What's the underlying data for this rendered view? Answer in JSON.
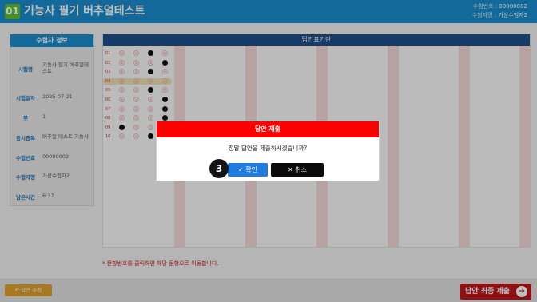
{
  "header": {
    "number": "01",
    "title": "기능사 필기 버추얼테스트",
    "exam_no_label": "수험번호 :",
    "exam_no": "00000002",
    "name_label": "수험자명 :",
    "name": "가상수험자2"
  },
  "info_panel": {
    "title": "수험자 정보",
    "rows": [
      {
        "key": "시험명",
        "value": "기능사 필기 버추얼테스트"
      },
      {
        "key": "시험일자",
        "value": "2025-07-21"
      },
      {
        "key": "부",
        "value": "1"
      },
      {
        "key": "응시종목",
        "value": "버추얼 테스트 기능사"
      },
      {
        "key": "수험번호",
        "value": "00000002"
      },
      {
        "key": "수험자명",
        "value": "가상수험자2"
      },
      {
        "key": "남은시간",
        "value": "6:37"
      }
    ]
  },
  "answer_sheet": {
    "title": "답안표기란",
    "options": [
      "①",
      "②",
      "③",
      "④"
    ],
    "questions": [
      {
        "number": "01",
        "selected": 3
      },
      {
        "number": "02",
        "selected": 4
      },
      {
        "number": "03",
        "selected": 3
      },
      {
        "number": "04",
        "selected": 0
      },
      {
        "number": "05",
        "selected": 3
      },
      {
        "number": "06",
        "selected": 4
      },
      {
        "number": "07",
        "selected": 4
      },
      {
        "number": "08",
        "selected": 4
      },
      {
        "number": "09",
        "selected": 1
      },
      {
        "number": "10",
        "selected": 3
      }
    ]
  },
  "note": "* 문항번호를 클릭하면 해당 문항으로 이동합니다.",
  "footer": {
    "back_label": "↶ 답안 수정",
    "submit_label": "답안 최종 제출",
    "submit_icon": "arrow-right-circle-icon"
  },
  "dialog": {
    "title": "답안 제출",
    "message": "정말 답안을 제출하시겠습니까?",
    "ok_label": "✓ 확인",
    "cancel_label": "✕ 취소"
  },
  "step_marker": "3",
  "colors": {
    "header_blue": "#1a8ccc",
    "sheet_header": "#20508c",
    "dialog_red": "#ff0000",
    "submit_red": "#c0171a",
    "ok_blue": "#1e7be0"
  }
}
